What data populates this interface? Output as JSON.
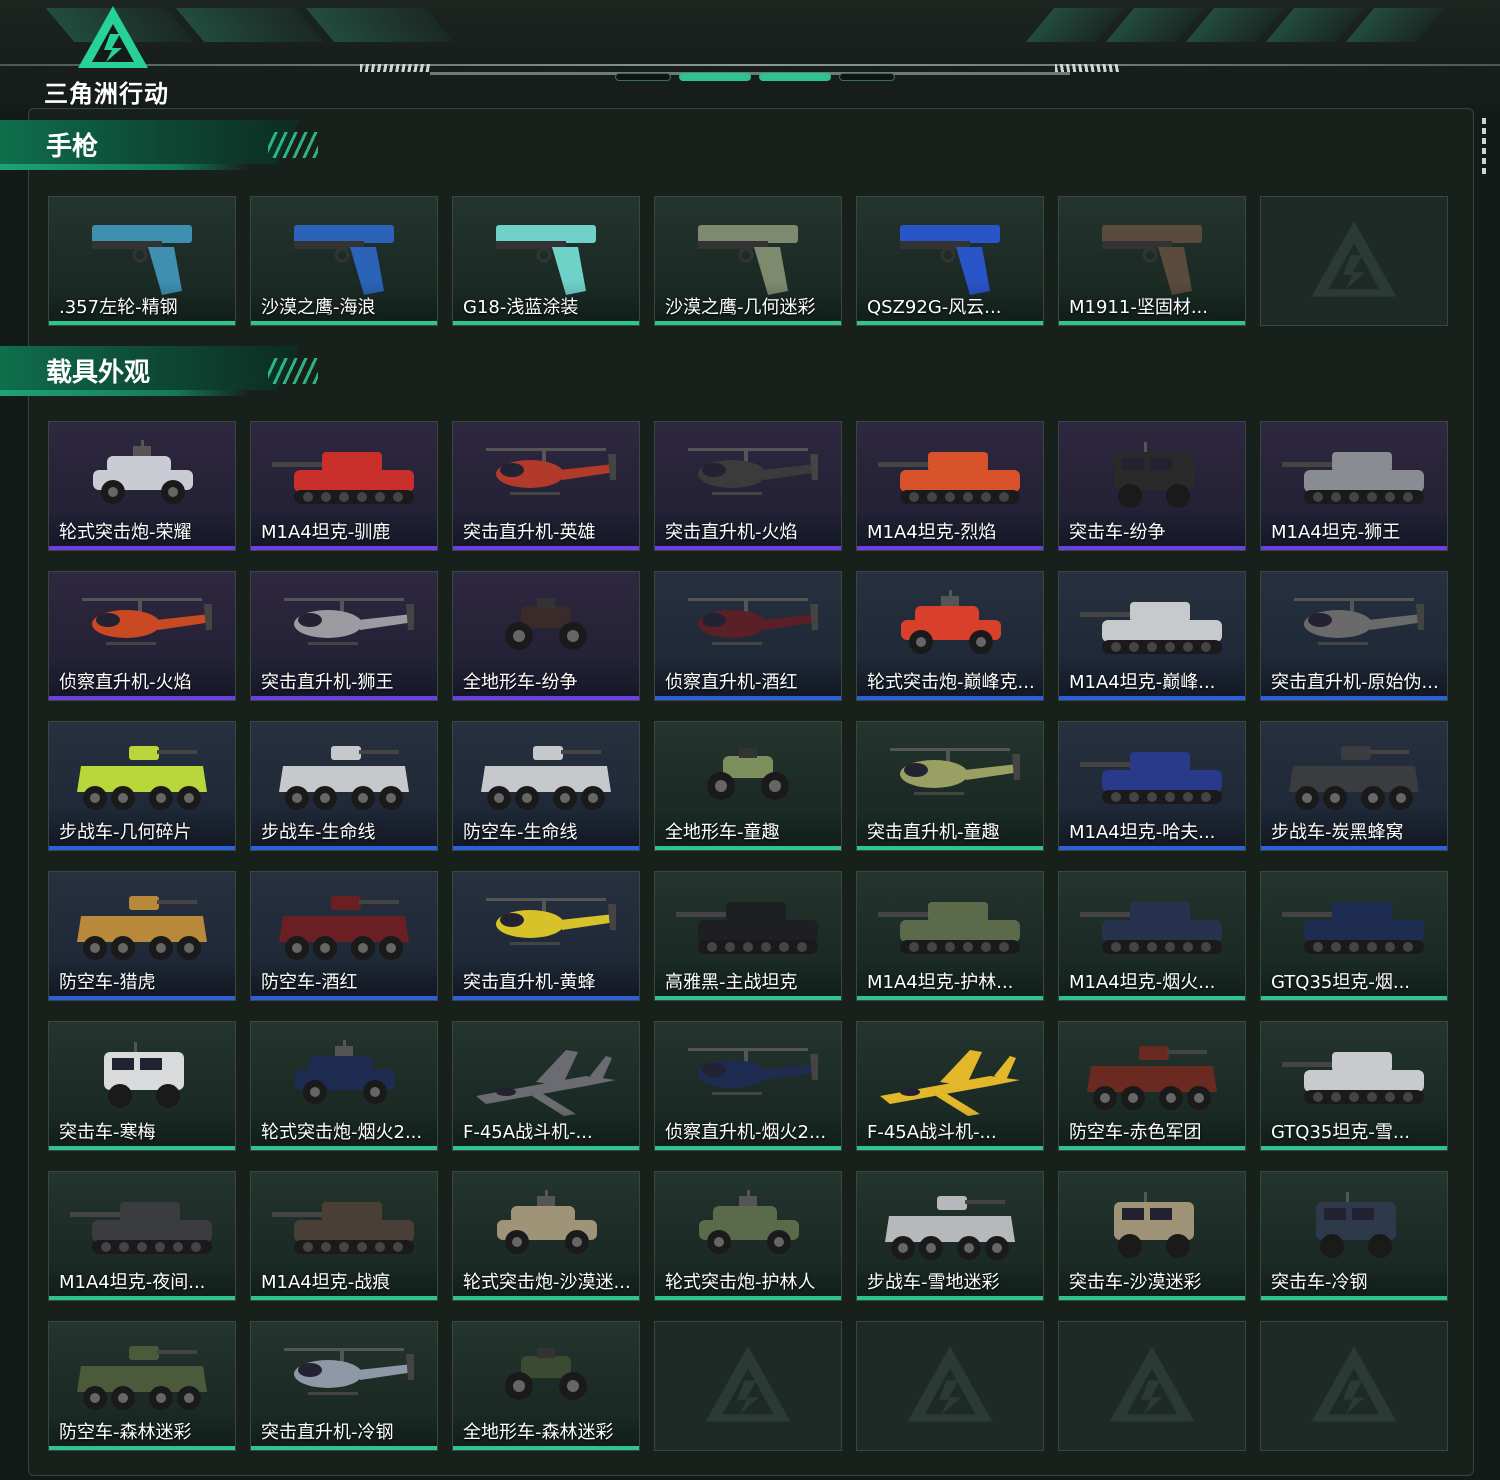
{
  "app": {
    "logo_text": "三角洲行动"
  },
  "sections": [
    {
      "title": "手枪",
      "cards": [
        {
          "label": ".357左轮-精钢",
          "tier": "green",
          "kind": "pistol",
          "color": "#3f8fb0"
        },
        {
          "label": "沙漠之鹰-海浪",
          "tier": "green",
          "kind": "pistol",
          "color": "#2b63b8"
        },
        {
          "label": "G18-浅蓝涂装",
          "tier": "green",
          "kind": "pistol",
          "color": "#6fd1c8"
        },
        {
          "label": "沙漠之鹰-几何迷彩",
          "tier": "green",
          "kind": "pistol",
          "color": "#7e8a6d"
        },
        {
          "label": "QSZ92G-风云...",
          "tier": "green",
          "kind": "pistol",
          "color": "#2a55c8"
        },
        {
          "label": "M1911-坚固材...",
          "tier": "green",
          "kind": "pistol",
          "color": "#5a4b3c"
        },
        {
          "label": "",
          "tier": "empty",
          "kind": "empty",
          "color": ""
        }
      ]
    },
    {
      "title": "载具外观",
      "cards": [
        {
          "label": "轮式突击炮-荣耀",
          "tier": "purple",
          "kind": "car",
          "color": "#c9ccd2"
        },
        {
          "label": "M1A4坦克-驯鹿",
          "tier": "purple",
          "kind": "tank",
          "color": "#c9302c"
        },
        {
          "label": "突击直升机-英雄",
          "tier": "purple",
          "kind": "heli",
          "color": "#b23a2a"
        },
        {
          "label": "突击直升机-火焰",
          "tier": "purple",
          "kind": "heli",
          "color": "#3b3b3b"
        },
        {
          "label": "M1A4坦克-烈焰",
          "tier": "purple",
          "kind": "tank",
          "color": "#d8532a"
        },
        {
          "label": "突击车-纷争",
          "tier": "purple",
          "kind": "truck",
          "color": "#2a2a2a"
        },
        {
          "label": "M1A4坦克-狮王",
          "tier": "purple",
          "kind": "tank",
          "color": "#8a8c93"
        },
        {
          "label": "侦察直升机-火焰",
          "tier": "purple",
          "kind": "heli",
          "color": "#c94a22"
        },
        {
          "label": "突击直升机-狮王",
          "tier": "purple",
          "kind": "heli",
          "color": "#9a9ca2"
        },
        {
          "label": "全地形车-纷争",
          "tier": "purple",
          "kind": "atv",
          "color": "#3a2a2a"
        },
        {
          "label": "侦察直升机-酒红",
          "tier": "blue",
          "kind": "heli",
          "color": "#5a1f27"
        },
        {
          "label": "轮式突击炮-巅峰克...",
          "tier": "blue",
          "kind": "car",
          "color": "#d8402c"
        },
        {
          "label": "M1A4坦克-巅峰...",
          "tier": "blue",
          "kind": "tank",
          "color": "#c8c9cc"
        },
        {
          "label": "突击直升机-原始伪...",
          "tier": "blue",
          "kind": "heli",
          "color": "#6a6a6a"
        },
        {
          "label": "步战车-几何碎片",
          "tier": "blue",
          "kind": "ifv",
          "color": "#b9d63a"
        },
        {
          "label": "步战车-生命线",
          "tier": "blue",
          "kind": "ifv",
          "color": "#c6c8cc"
        },
        {
          "label": "防空车-生命线",
          "tier": "blue",
          "kind": "ifv",
          "color": "#c6c8cc"
        },
        {
          "label": "全地形车-童趣",
          "tier": "green",
          "kind": "atv",
          "color": "#7c8f5c"
        },
        {
          "label": "突击直升机-童趣",
          "tier": "green",
          "kind": "heli",
          "color": "#9aa064"
        },
        {
          "label": "M1A4坦克-哈夫...",
          "tier": "blue",
          "kind": "tank",
          "color": "#2a3a8a"
        },
        {
          "label": "步战车-炭黑蜂窝",
          "tier": "blue",
          "kind": "ifv",
          "color": "#3a3c40"
        },
        {
          "label": "防空车-猎虎",
          "tier": "blue",
          "kind": "ifv",
          "color": "#b8893a"
        },
        {
          "label": "防空车-酒红",
          "tier": "blue",
          "kind": "ifv",
          "color": "#6a1f22"
        },
        {
          "label": "突击直升机-黄蜂",
          "tier": "blue",
          "kind": "heli",
          "color": "#d8c22a"
        },
        {
          "label": "高雅黑-主战坦克",
          "tier": "green",
          "kind": "tank",
          "color": "#1e1f22"
        },
        {
          "label": "M1A4坦克-护林...",
          "tier": "green",
          "kind": "tank",
          "color": "#5c6a4c"
        },
        {
          "label": "M1A4坦克-烟火...",
          "tier": "green",
          "kind": "tank",
          "color": "#26324e"
        },
        {
          "label": "GTQ35坦克-烟...",
          "tier": "green",
          "kind": "tank",
          "color": "#1f2c52"
        },
        {
          "label": "突击车-寒梅",
          "tier": "green",
          "kind": "truck",
          "color": "#d8dadc"
        },
        {
          "label": "轮式突击炮-烟火2...",
          "tier": "green",
          "kind": "car",
          "color": "#1f2c52"
        },
        {
          "label": "F-45A战斗机-...",
          "tier": "green",
          "kind": "jet",
          "color": "#6a6c72"
        },
        {
          "label": "侦察直升机-烟火2...",
          "tier": "green",
          "kind": "heli",
          "color": "#1f2c52"
        },
        {
          "label": "F-45A战斗机-...",
          "tier": "green",
          "kind": "jet",
          "color": "#e2b82a"
        },
        {
          "label": "防空车-赤色军团",
          "tier": "green",
          "kind": "ifv",
          "color": "#6a2a22"
        },
        {
          "label": "GTQ35坦克-雪...",
          "tier": "green",
          "kind": "tank",
          "color": "#c8cacd"
        },
        {
          "label": "M1A4坦克-夜间...",
          "tier": "green",
          "kind": "tank",
          "color": "#3a3c40"
        },
        {
          "label": "M1A4坦克-战痕",
          "tier": "green",
          "kind": "tank",
          "color": "#4a3f36"
        },
        {
          "label": "轮式突击炮-沙漠迷...",
          "tier": "green",
          "kind": "car",
          "color": "#a09478"
        },
        {
          "label": "轮式突击炮-护林人",
          "tier": "green",
          "kind": "car",
          "color": "#5c6a4c"
        },
        {
          "label": "步战车-雪地迷彩",
          "tier": "green",
          "kind": "ifv",
          "color": "#b6b8bc"
        },
        {
          "label": "突击车-沙漠迷彩",
          "tier": "green",
          "kind": "truck",
          "color": "#a09478"
        },
        {
          "label": "突击车-冷钢",
          "tier": "green",
          "kind": "truck",
          "color": "#2e3a4c"
        },
        {
          "label": "防空车-森林迷彩",
          "tier": "green",
          "kind": "ifv",
          "color": "#4c5a3c"
        },
        {
          "label": "突击直升机-冷钢",
          "tier": "green",
          "kind": "heli",
          "color": "#8e98a6"
        },
        {
          "label": "全地形车-森林迷彩",
          "tier": "green",
          "kind": "atv",
          "color": "#3c4a32"
        },
        {
          "label": "",
          "tier": "empty",
          "kind": "empty",
          "color": ""
        },
        {
          "label": "",
          "tier": "empty",
          "kind": "empty",
          "color": ""
        },
        {
          "label": "",
          "tier": "empty",
          "kind": "empty",
          "color": ""
        },
        {
          "label": "",
          "tier": "empty",
          "kind": "empty",
          "color": ""
        }
      ]
    }
  ]
}
